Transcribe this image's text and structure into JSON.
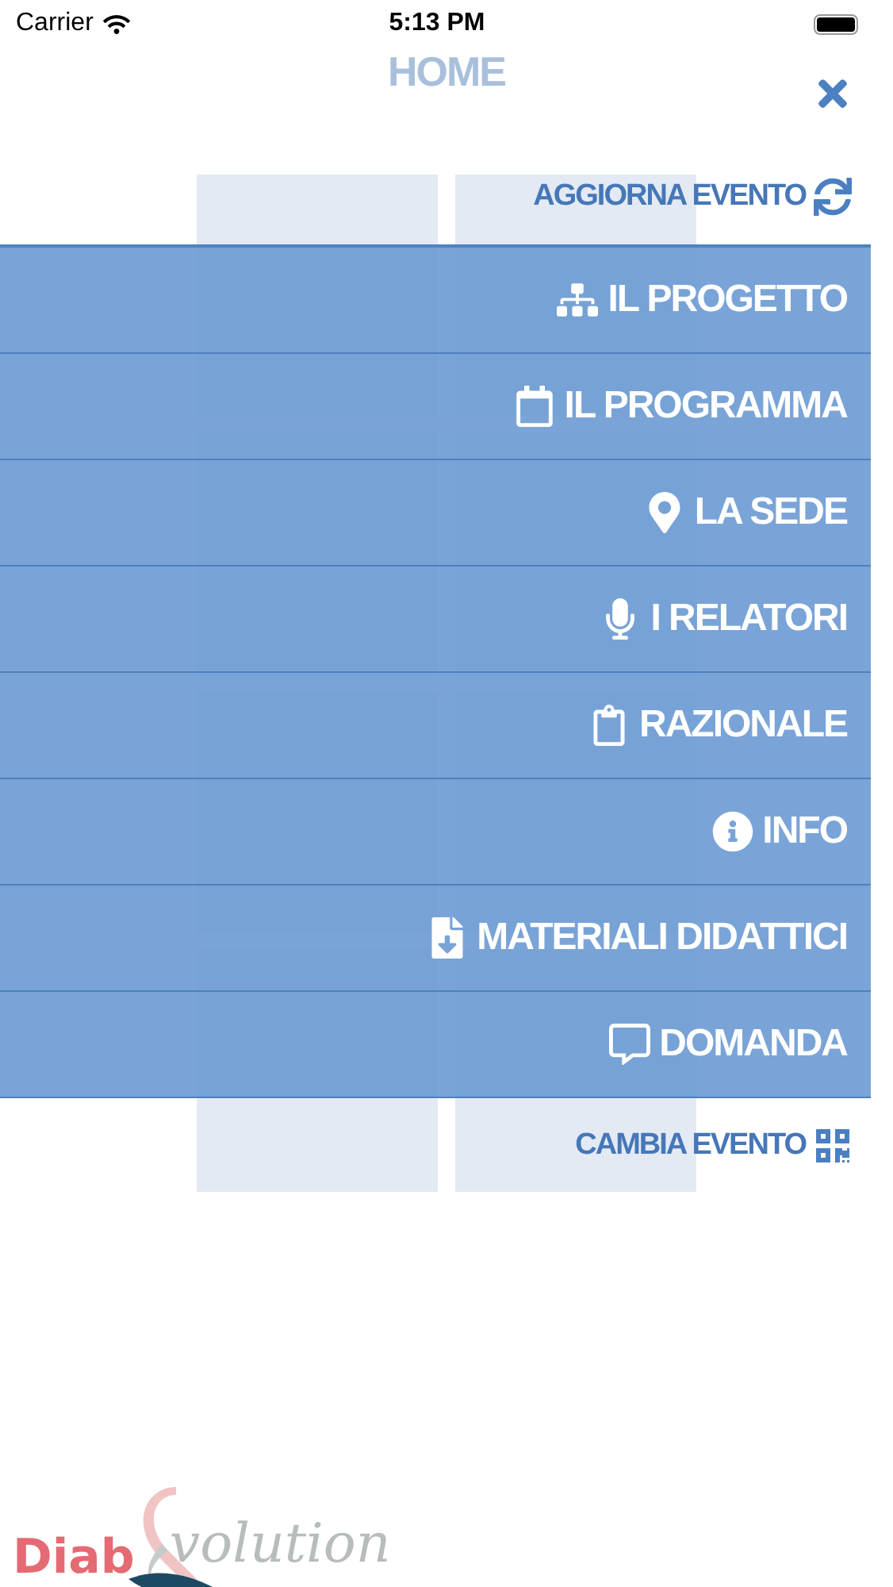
{
  "status_bar": {
    "carrier": "Carrier",
    "time": "5:13 PM"
  },
  "page_title": "HOME",
  "refresh_link": "AGGIORNA EVENTO",
  "menu": [
    {
      "label": "IL PROGETTO"
    },
    {
      "label": "IL PROGRAMMA"
    },
    {
      "label": "LA SEDE"
    },
    {
      "label": "I RELATORI"
    },
    {
      "label": "RAZIONALE"
    },
    {
      "label": "INFO"
    },
    {
      "label": "MATERIALI DIDATTICI"
    },
    {
      "label": "DOMANDA"
    }
  ],
  "change_link": "CAMBIA EVENTO",
  "logo": {
    "part_1": "Diab",
    "part_2": "volution"
  }
}
